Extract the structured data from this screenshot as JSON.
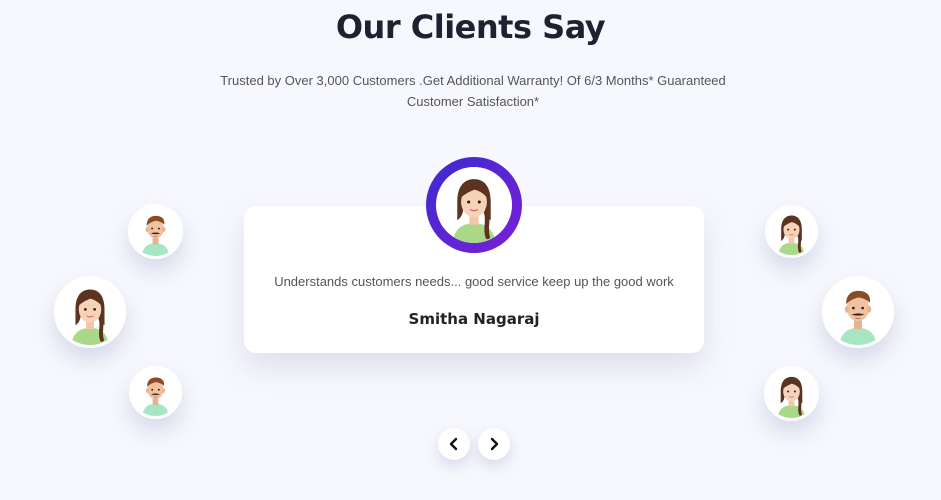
{
  "section": {
    "title": "Our Clients Say",
    "subtitle": "Trusted by Over 3,000 Customers .Get Additional Warranty! Of 6/3 Months* Guaranteed Customer Satisfaction*"
  },
  "testimonial": {
    "quote": "Understands customers needs... good service keep up the good work",
    "name": "Smitha Nagaraj"
  },
  "avatars": [
    {
      "type": "male-icon"
    },
    {
      "type": "female-icon"
    },
    {
      "type": "male-icon"
    },
    {
      "type": "female-icon"
    },
    {
      "type": "male-icon"
    },
    {
      "type": "female-icon"
    }
  ],
  "navigation": {
    "prev_icon": "chevron-left-icon",
    "next_icon": "chevron-right-icon"
  },
  "colors": {
    "background": "#f7f8fd",
    "accent_start": "#3b2bd0",
    "accent_end": "#7a1fd6"
  }
}
